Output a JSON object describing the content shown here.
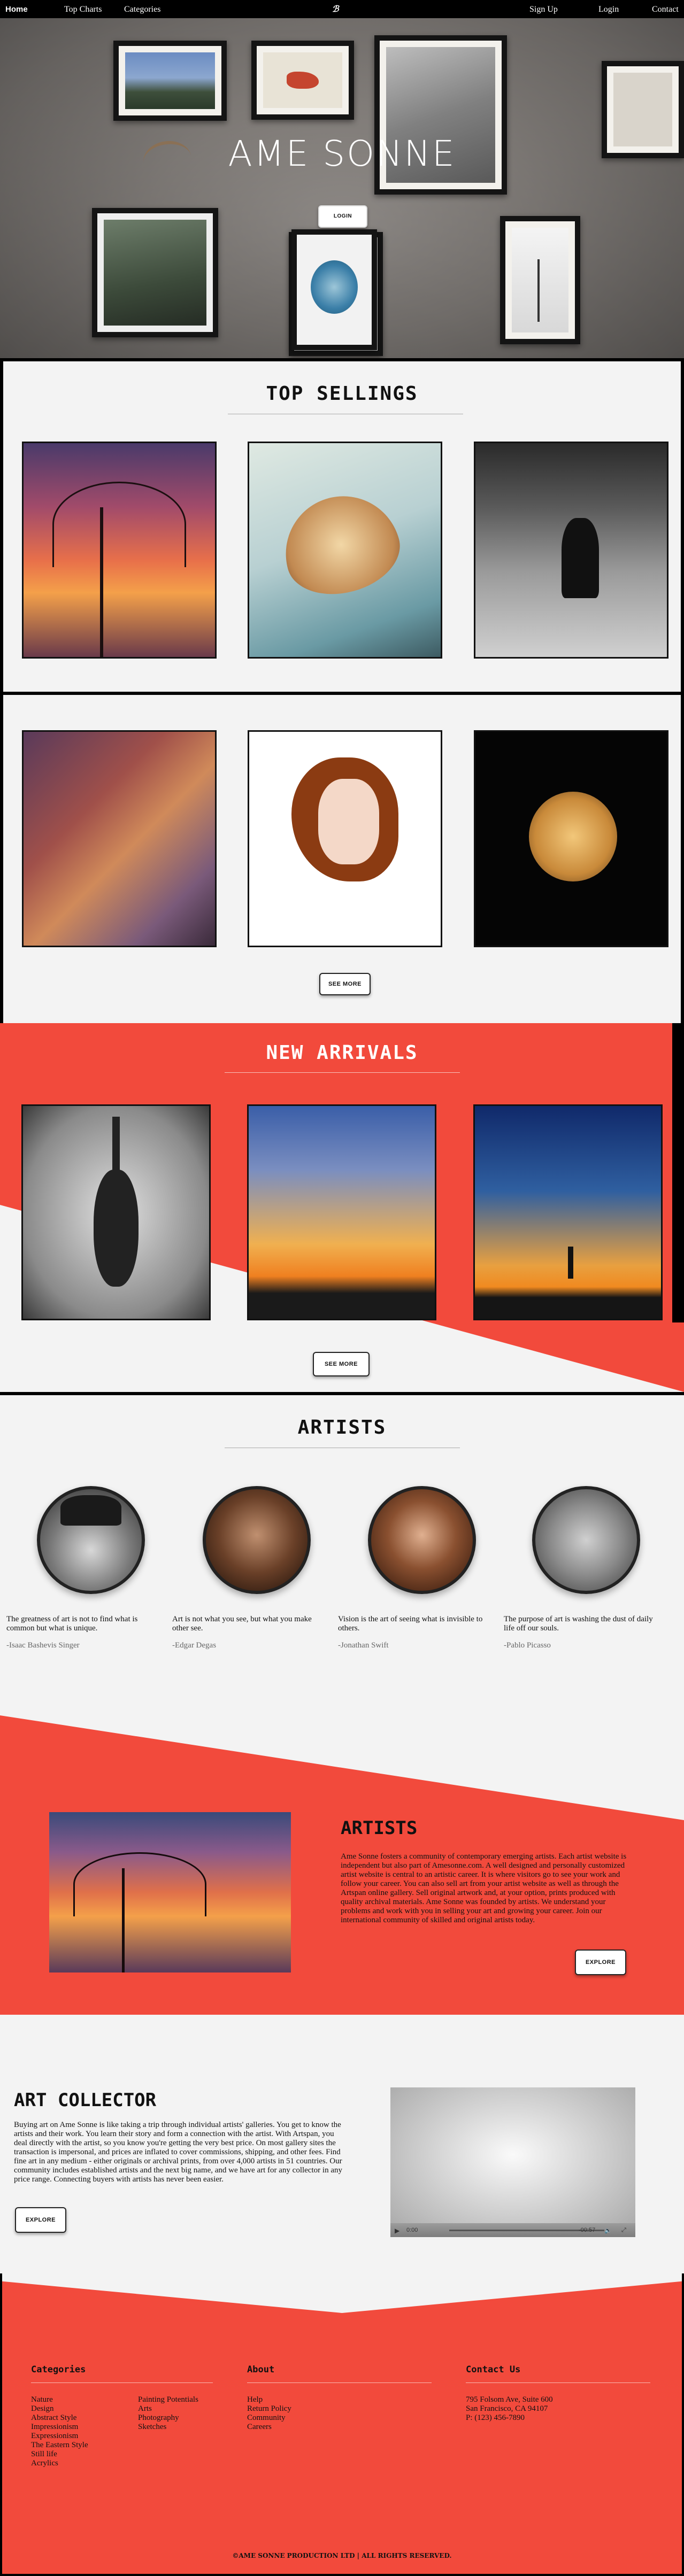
{
  "nav": {
    "home": "Home",
    "top_charts": "Top Charts",
    "categories": "Categories",
    "logo": "ℬ",
    "sign_up": "Sign Up",
    "login": "Login",
    "contact": "Contact"
  },
  "hero": {
    "title": "AME SONNE",
    "login_button": "LOGIN"
  },
  "top_sellings": {
    "heading": "TOP SELLINGS",
    "see_more": "SEE MORE"
  },
  "new_arrivals": {
    "heading": "NEW ARRIVALS",
    "see_more": "SEE MORE"
  },
  "artists_section": {
    "heading": "ARTISTS",
    "items": [
      {
        "quote": "The greatness of art is not to find what is common but what is unique.",
        "author": "-Isaac Bashevis Singer"
      },
      {
        "quote": "Art is not what you see, but what you make other see.",
        "author": "-Edgar Degas"
      },
      {
        "quote": "Vision is the art of seeing what is invisible to others.",
        "author": "-Jonathan Swift"
      },
      {
        "quote": "The purpose of art is washing the dust of daily life off our souls.",
        "author": "-Pablo Picasso"
      }
    ]
  },
  "feature": {
    "heading": "ARTISTS",
    "body": "Ame Sonne fosters a community of contemporary emerging artists. Each artist website is independent but also part of Amesonne.com. A well designed and personally customized artist website is central to an artistic career. It is where visitors go to see your work and follow your career. You can also sell art from your artist website as well as through the Artspan online gallery. Sell original artwork and, at your option, prints produced with quality archival materials. Ame Sonne was founded by artists. We understand your problems and work with you in selling your art and growing your career. Join our international community of skilled and original artists today.",
    "button": "EXPLORE"
  },
  "collector": {
    "heading": "ART COLLECTOR",
    "body": "Buying art on Ame Sonne is like taking a trip through individual artists' galleries. You get to know the artists and their work. You learn their story and form a connection with the artist. With Artspan, you deal directly with the artist, so you know you're getting the very best price. On most gallery sites the transaction is impersonal, and prices are inflated to cover commissions, shipping, and other fees. Find fine art in any medium - either originals or archival prints, from over 4,000 artists in 51 countries. Our community includes established artists and the next big name, and we have art for any collector in any price range. Connecting buyers with artists has never been easier.",
    "button": "EXPLORE",
    "video_time": "0:00",
    "video_duration": "-00:57"
  },
  "footer": {
    "categories_heading": "Categories",
    "categories_col1": [
      "Nature",
      "Design",
      "Abstract Style",
      "Impressionism",
      "Expressionism",
      "The Eastern Style",
      "Still life",
      "Acrylics"
    ],
    "categories_col2": [
      "Painting Potentials",
      "Arts",
      "Photography",
      "Sketches"
    ],
    "about_heading": "About",
    "about_items": [
      "Help",
      "Return Policy",
      "Community",
      "Careers"
    ],
    "contact_heading": "Contact Us",
    "address_lines": [
      "795 Folsom Ave, Suite 600",
      "San Francisco, CA 94107",
      "P: (123) 456-7890"
    ],
    "copyright": "©AME SONNE PRODUCTION LTD | ALL RIGHTS RESERVED."
  },
  "colors": {
    "accent_red": "#f24a3c",
    "panel_grey": "#f3f3f3",
    "nav_black": "#000000"
  }
}
